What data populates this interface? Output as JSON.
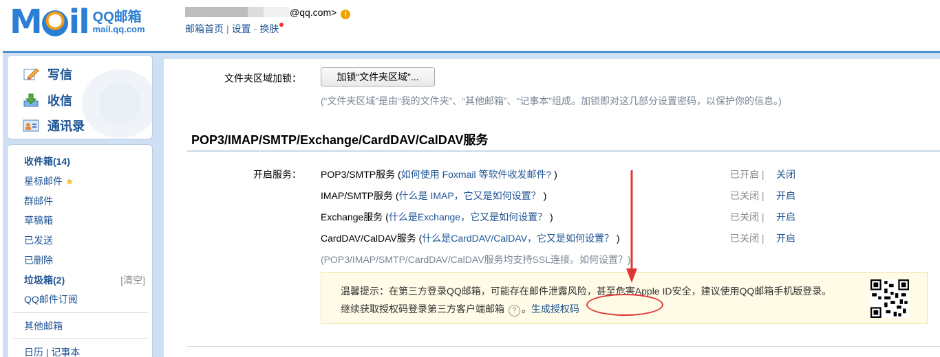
{
  "header": {
    "logo_word": "MQil",
    "logo_cn": "QQ邮箱",
    "logo_url": "mail.qq.com",
    "email_suffix": "@qq.com>",
    "warn_icon": "!",
    "links": [
      "邮箱首页",
      "设置",
      "换肤"
    ],
    "sep1": "|",
    "sep2": "-"
  },
  "sidebar": {
    "compose": "写信",
    "receive": "收信",
    "contacts": "通讯录",
    "folders": [
      {
        "label": "收件箱(14)",
        "bold": true
      },
      {
        "label": "星标邮件",
        "star": true
      },
      {
        "label": "群邮件"
      },
      {
        "label": "草稿箱"
      },
      {
        "label": "已发送"
      },
      {
        "label": "已删除"
      },
      {
        "label": "垃圾箱(2)",
        "bold": true
      },
      {
        "label": "QQ邮件订阅"
      }
    ],
    "clear_label": "[清空]",
    "other_mailbox": "其他邮箱",
    "calendar_notes": "日历 | 记事本"
  },
  "main": {
    "folder_lock_label": "文件夹区域加锁：",
    "folder_lock_button": "加锁“文件夹区域”...",
    "folder_lock_note": "(“文件夹区域”是由“我的文件夹”、“其他邮箱”、“记事本”组成。加锁即对这几部分设置密码，以保护你的信息。)",
    "section_title": "POP3/IMAP/SMTP/Exchange/CardDAV/CalDAV服务",
    "enable_label": "开启服务：",
    "services": [
      {
        "name": "POP3/SMTP服务 (",
        "link": "如何使用 Foxmail 等软件收发邮件?",
        "close": " )",
        "state": "已开启 |",
        "action": "关闭"
      },
      {
        "name": "IMAP/SMTP服务 (",
        "link": "什么是 IMAP，它又是如何设置？",
        "close": " )",
        "state": "已关闭 |",
        "action": "开启"
      },
      {
        "name": "Exchange服务 (",
        "link": "什么是Exchange，它又是如何设置？",
        "close": " )",
        "state": "已关闭 |",
        "action": "开启"
      },
      {
        "name": "CardDAV/CalDAV服务 (",
        "link": "什么是CardDAV/CalDAV，它又是如何设置？",
        "close": " )",
        "state": "已关闭 |",
        "action": "开启"
      }
    ],
    "ssl_note": "(POP3/IMAP/SMTP/CardDAV/CalDAV服务均支持SSL连接。",
    "ssl_link": "如何设置？",
    "ssl_close": ")",
    "tip_line1": "温馨提示：在第三方登录QQ邮箱，可能存在邮件泄露风险，甚至危害Apple ID安全，建议使用QQ邮箱手机版登录。",
    "tip_line2_prefix": "继续获取授权码登录第三方客户端邮箱",
    "help_icon": "?",
    "tip_line2_mid": "。",
    "generate_link": "生成授权码"
  },
  "colors": {
    "accent": "#1e5494",
    "brand": "#2a7ed3",
    "annotation": "#e03535",
    "tip_bg": "#fffbe7"
  }
}
